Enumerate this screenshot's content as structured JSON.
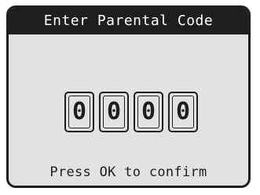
{
  "dialog": {
    "title": "Enter Parental Code",
    "digits": [
      "0",
      "0",
      "0",
      "0"
    ],
    "hint": "Press OK to confirm"
  },
  "colors": {
    "frame": "#1e1e1e",
    "background": "#e2e2e2",
    "title_text": "#ffffff"
  }
}
